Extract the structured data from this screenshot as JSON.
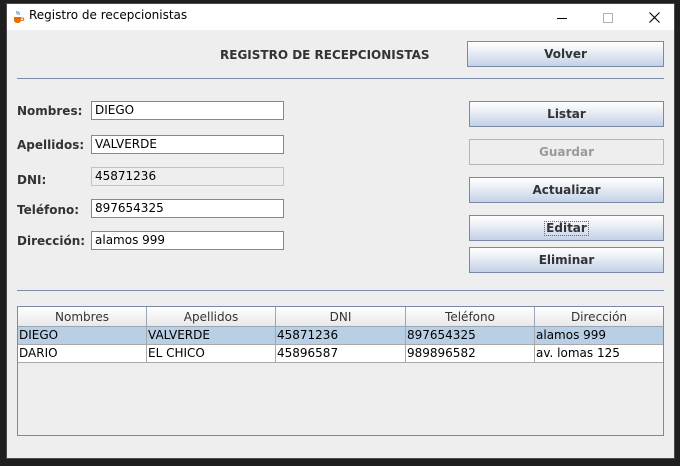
{
  "window": {
    "title": "Registro de recepcionistas",
    "heading": "REGISTRO DE RECEPCIONISTAS"
  },
  "buttons": {
    "volver": "Volver",
    "listar": "Listar",
    "guardar": "Guardar",
    "actualizar": "Actualizar",
    "editar": "Editar",
    "eliminar": "Eliminar"
  },
  "form": {
    "nombres": {
      "label": "Nombres:",
      "value": "DIEGO"
    },
    "apellidos": {
      "label": "Apellidos:",
      "value": "VALVERDE"
    },
    "dni": {
      "label": "DNI:",
      "value": "45871236"
    },
    "telefono": {
      "label": "Teléfono:",
      "value": "897654325"
    },
    "direccion": {
      "label": "Dirección:",
      "value": "alamos 999"
    }
  },
  "table": {
    "columns": [
      "Nombres",
      "Apellidos",
      "DNI",
      "Teléfono",
      "Dirección"
    ],
    "rows": [
      [
        "DIEGO",
        "VALVERDE",
        "45871236",
        "897654325",
        "alamos 999"
      ],
      [
        "DARIO",
        "EL CHICO",
        "45896587",
        "989896582",
        "av. lomas 125"
      ]
    ],
    "selected_row": 0
  },
  "colors": {
    "selection": "#b8cfe5",
    "separator": "#7a8ca8",
    "button_gradient_bottom": "#c3d1e6"
  },
  "icons": {
    "app": "java-cup-icon",
    "minimize": "minimize-icon",
    "maximize": "maximize-icon",
    "close": "close-icon"
  }
}
